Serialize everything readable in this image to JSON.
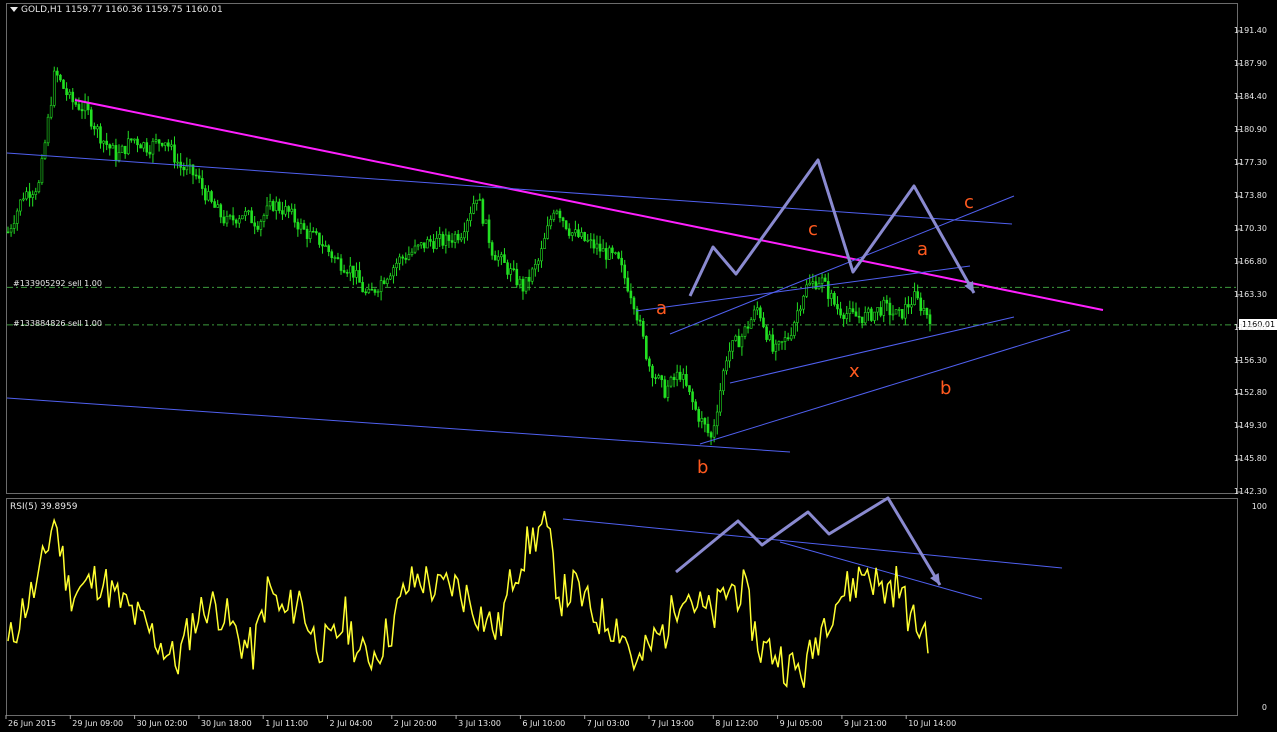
{
  "symbol_header": "GOLD,H1  1159.77 1160.36 1159.75 1160.01",
  "rsi_header": "RSI(5) 39.8959",
  "current_price": "1160.01",
  "price_axis": [
    "1191.40",
    "1187.90",
    "1184.40",
    "1180.90",
    "1177.30",
    "1173.80",
    "1170.30",
    "1166.80",
    "1163.30",
    "1159.80",
    "1156.30",
    "1152.80",
    "1149.30",
    "1145.80",
    "1142.30"
  ],
  "rsi_axis": [
    "100",
    "0"
  ],
  "time_axis": [
    "26 Jun 2015",
    "29 Jun 09:00",
    "30 Jun 02:00",
    "30 Jun 18:00",
    "1 Jul 11:00",
    "2 Jul 04:00",
    "2 Jul 20:00",
    "3 Jul 13:00",
    "6 Jul 10:00",
    "7 Jul 03:00",
    "7 Jul 19:00",
    "8 Jul 12:00",
    "9 Jul 05:00",
    "9 Jul 21:00",
    "10 Jul 14:00"
  ],
  "orders": [
    {
      "label": "#133905292 sell 1.00",
      "price": 1164.1
    },
    {
      "label": "#133884826 sell 1.00",
      "price": 1160.1
    }
  ],
  "wave_labels": [
    "a",
    "b",
    "c",
    "x",
    "a",
    "b",
    "c"
  ],
  "colors": {
    "candle": "#22e022",
    "rsi": "#ffff30",
    "trend": "#ff20ff",
    "channel": "#5060f0",
    "arrow": "#8a8ad0",
    "wave_label": "#ff5a1f",
    "order_line": "#3c9a3c"
  },
  "chart_data": [
    {
      "type": "candlestick",
      "title": "GOLD,H1",
      "ohlc_last": {
        "open": 1159.77,
        "high": 1160.36,
        "low": 1159.75,
        "close": 1160.01
      },
      "ylim": [
        1142.3,
        1191.4
      ],
      "x_ticks": [
        "26 Jun 2015",
        "29 Jun 09:00",
        "30 Jun 02:00",
        "30 Jun 18:00",
        "1 Jul 11:00",
        "2 Jul 04:00",
        "2 Jul 20:00",
        "3 Jul 13:00",
        "6 Jul 10:00",
        "7 Jul 03:00",
        "7 Jul 19:00",
        "8 Jul 12:00",
        "9 Jul 05:00",
        "9 Jul 21:00",
        "10 Jul 14:00"
      ],
      "close_path": [
        1170,
        1174,
        1175,
        1187,
        1184,
        1183,
        1180,
        1178,
        1180,
        1179,
        1180,
        1177,
        1176,
        1173,
        1171,
        1172,
        1171,
        1173,
        1172,
        1170,
        1169,
        1167,
        1166,
        1163,
        1165,
        1167,
        1168,
        1169,
        1169,
        1170,
        1174,
        1168,
        1166,
        1164,
        1167,
        1173,
        1170,
        1169,
        1168,
        1167,
        1163,
        1156,
        1153,
        1155,
        1151,
        1148,
        1157,
        1159,
        1162,
        1157,
        1159,
        1164,
        1165,
        1162,
        1161,
        1161,
        1162,
        1161,
        1163,
        1161
      ]
    },
    {
      "type": "line",
      "title": "RSI(5)",
      "last_value": 39.8959,
      "ylim": [
        0,
        100
      ],
      "values": [
        30,
        50,
        62,
        95,
        58,
        60,
        65,
        55,
        48,
        40,
        32,
        22,
        42,
        52,
        48,
        35,
        28,
        60,
        45,
        55,
        34,
        30,
        45,
        25,
        28,
        40,
        60,
        65,
        58,
        62,
        55,
        45,
        38,
        68,
        82,
        92,
        55,
        60,
        48,
        44,
        40,
        20,
        32,
        40,
        62,
        50,
        45,
        60,
        58,
        30,
        28,
        20,
        18,
        40,
        55,
        60,
        70,
        58,
        62,
        42,
        38
      ]
    }
  ]
}
